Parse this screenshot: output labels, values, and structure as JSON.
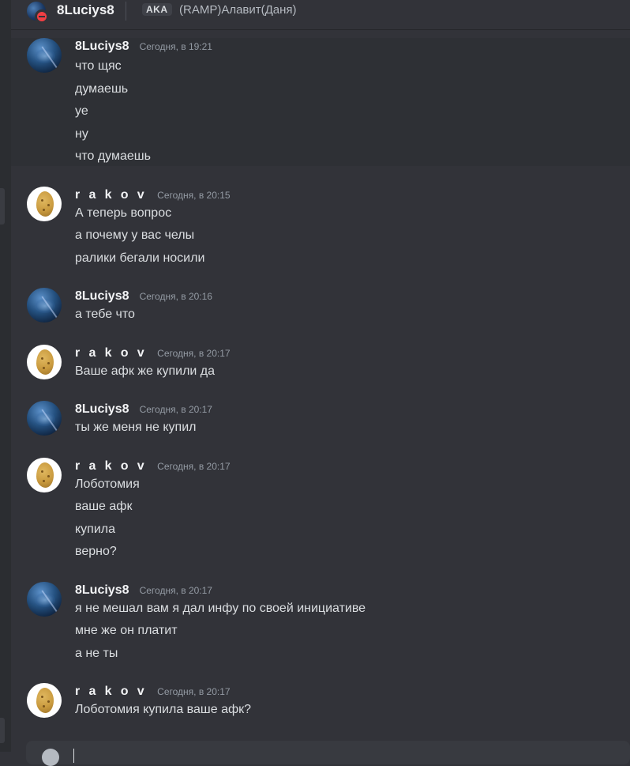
{
  "header": {
    "username": "8Luciys8",
    "aka_label": "AKA",
    "aka_names": "(RAMP)Алавит(Даня)"
  },
  "messages": [
    {
      "author": "8Luciys8",
      "avatar": "blue-space-avatar",
      "timestamp": "Сегодня, в 19:21",
      "lines": [
        "что щяс",
        "думаешь",
        "уе",
        "ну",
        "что думаешь"
      ]
    },
    {
      "author": "r a k o v",
      "avatar": "potato-avatar",
      "timestamp": "Сегодня, в 20:15",
      "lines": [
        "А теперь вопрос",
        "а почему у вас челы",
        "ралики бегали носили"
      ]
    },
    {
      "author": "8Luciys8",
      "avatar": "blue-space-avatar",
      "timestamp": "Сегодня, в 20:16",
      "lines": [
        "а тебе что"
      ]
    },
    {
      "author": "r a k o v",
      "avatar": "potato-avatar",
      "timestamp": "Сегодня, в 20:17",
      "lines": [
        "Ваше афк же купили да"
      ]
    },
    {
      "author": "8Luciys8",
      "avatar": "blue-space-avatar",
      "timestamp": "Сегодня, в 20:17",
      "lines": [
        "ты же меня не купил"
      ]
    },
    {
      "author": "r a k o v",
      "avatar": "potato-avatar",
      "timestamp": "Сегодня, в 20:17",
      "lines": [
        "Лоботомия",
        "ваше афк",
        "купила",
        "верно?"
      ]
    },
    {
      "author": "8Luciys8",
      "avatar": "blue-space-avatar",
      "timestamp": "Сегодня, в 20:17",
      "lines": [
        "я не мешал вам я дал инфу по своей инициативе",
        "мне же он платит",
        "а не ты"
      ]
    },
    {
      "author": "r a k o v",
      "avatar": "potato-avatar",
      "timestamp": "Сегодня, в 20:17",
      "lines": [
        "Лоботомия купила ваше афк?"
      ]
    }
  ]
}
